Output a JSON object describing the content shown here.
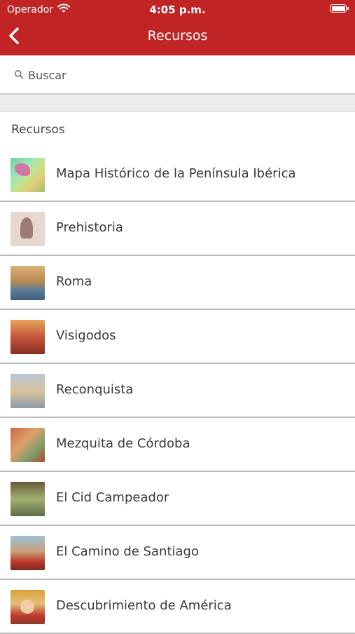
{
  "status_bar": {
    "carrier": "Operador",
    "time": "4:05 p.m."
  },
  "nav": {
    "title": "Recursos",
    "back_icon": "chevron-left-icon"
  },
  "search": {
    "placeholder": "Buscar",
    "icon": "search-icon"
  },
  "section": {
    "header": "Recursos"
  },
  "items": [
    {
      "label": "Mapa Histórico de la Península Ibérica"
    },
    {
      "label": "Prehistoria"
    },
    {
      "label": "Roma"
    },
    {
      "label": "Visigodos"
    },
    {
      "label": "Reconquista"
    },
    {
      "label": "Mezquita de Córdoba"
    },
    {
      "label": "El Cid Campeador"
    },
    {
      "label": "El Camino de Santiago"
    },
    {
      "label": "Descubrimiento de América"
    }
  ],
  "colors": {
    "accent": "#c02424",
    "separator": "#b8b8b8",
    "section_gap": "#ececec"
  }
}
